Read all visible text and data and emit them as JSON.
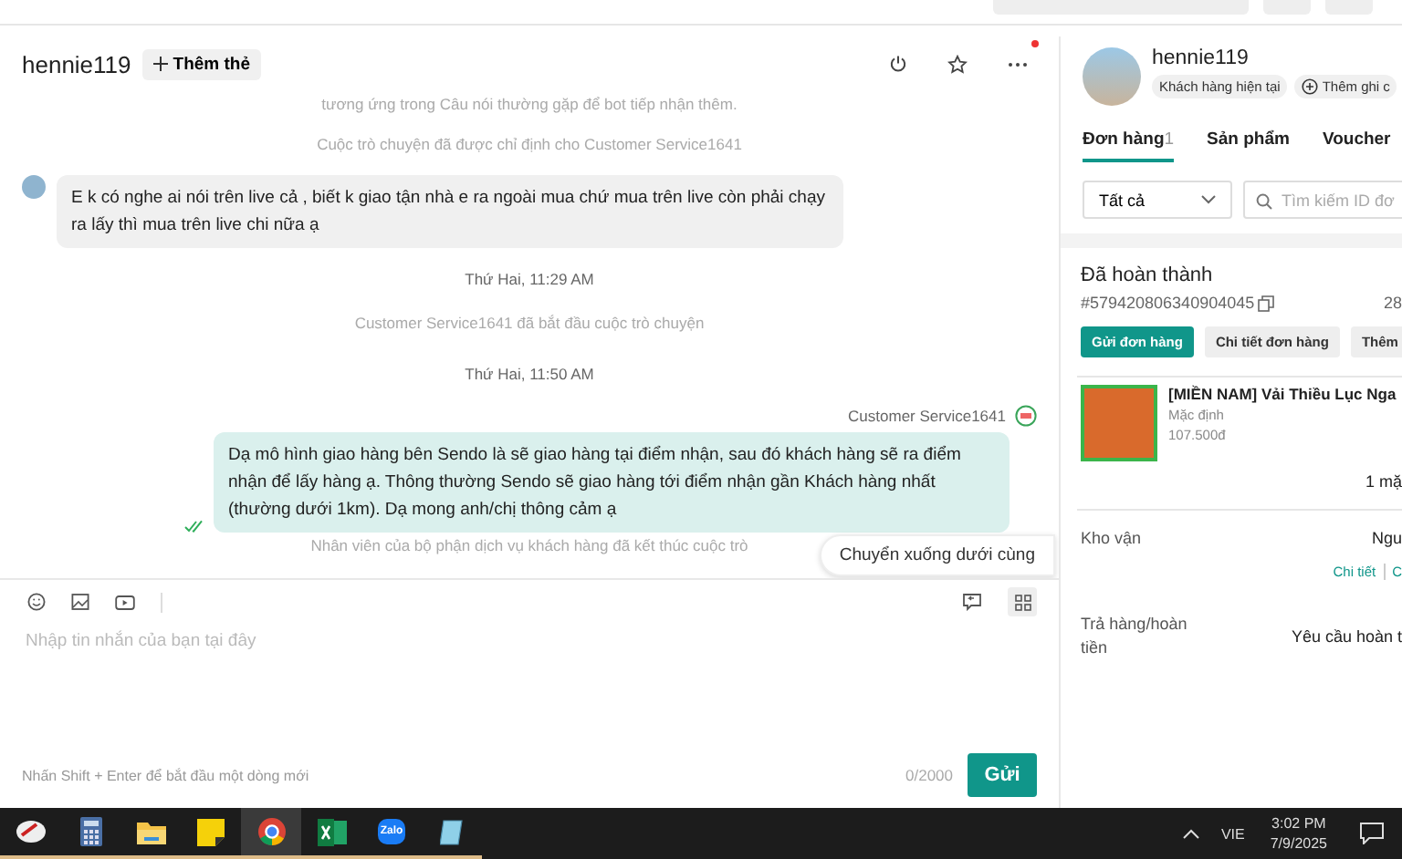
{
  "chat": {
    "header": {
      "username": "hennie119",
      "add_tag_button": "Thêm thẻ",
      "has_notification": true
    },
    "messages": [
      {
        "kind": "system",
        "text": "tương ứng trong Câu nói thường gặp để bot tiếp nhận thêm."
      },
      {
        "kind": "system",
        "text": "Cuộc trò chuyện đã được chỉ định cho Customer Service1641"
      },
      {
        "kind": "incoming",
        "text": "E k có nghe ai nói trên live cả , biết k giao tận nhà e ra ngoài mua chứ mua trên live còn phải chạy ra lấy thì mua trên live chi nữa ạ"
      },
      {
        "kind": "time",
        "text": "Thứ Hai, 11:29 AM"
      },
      {
        "kind": "system",
        "text": "Customer Service1641 đã bắt đầu cuộc trò chuyện"
      },
      {
        "kind": "time",
        "text": "Thứ Hai, 11:50 AM"
      },
      {
        "kind": "outgoing",
        "sender": "Customer Service1641",
        "read": true,
        "text": "Dạ mô hình giao hàng bên Sendo là sẽ giao hàng tại điểm nhận, sau đó khách hàng sẽ ra điểm nhận để lấy hàng ạ. Thông thường Sendo sẽ giao hàng tới điểm nhận gần Khách hàng nhất (thường dưới 1km). Dạ mong anh/chị thông cảm ạ"
      },
      {
        "kind": "system",
        "text": "Nhân viên của bộ phận dịch vụ khách hàng đã kết thúc cuộc trò"
      }
    ],
    "scroll_bottom_button": "Chuyển xuống dưới cùng",
    "composer": {
      "placeholder": "Nhập tin nhắn của bạn tại đây",
      "hint": "Nhấn Shift + Enter để bắt đầu một dòng mới",
      "counter": "0/2000",
      "send_button": "Gửi"
    }
  },
  "customer": {
    "name": "hennie119",
    "badge": "Khách hàng hiện tại",
    "add_note": "Thêm ghi c",
    "tabs": [
      {
        "label": "Đơn hàng",
        "count": "1",
        "selected": true
      },
      {
        "label": "Sản phẩm",
        "selected": false
      },
      {
        "label": "Voucher",
        "selected": false
      }
    ],
    "filter": {
      "value": "Tất cả"
    },
    "search": {
      "placeholder": "Tìm kiếm ID đơ"
    },
    "order": {
      "status": "Đã hoàn thành",
      "id": "#579420806340904045",
      "date": "28",
      "actions": [
        {
          "label": "Gửi đơn hàng",
          "primary": true
        },
        {
          "label": "Chi tiết đơn hàng",
          "primary": false
        },
        {
          "label": "Thêm",
          "primary": false
        }
      ],
      "product": {
        "name": "[MIỀN NAM] Vải Thiều Lục Nga",
        "variant": "Mặc định",
        "price": "107.500đ"
      },
      "quantity": "1 mặ",
      "shipping": {
        "label": "Kho vận",
        "value": "Ngu",
        "links": [
          "Chi tiết",
          "C"
        ]
      },
      "refund": {
        "label": "Trả hàng/hoàn tiền",
        "value": "Yêu cầu hoàn t"
      }
    }
  },
  "taskbar": {
    "apps": [
      {
        "kind": "tool",
        "selected": false
      },
      {
        "kind": "calculator",
        "selected": false
      },
      {
        "kind": "folder",
        "selected": false
      },
      {
        "kind": "notes",
        "selected": false
      },
      {
        "kind": "browser",
        "selected": true
      },
      {
        "kind": "excel",
        "selected": false
      },
      {
        "kind": "zalo",
        "label": "Zalo",
        "selected": false
      },
      {
        "kind": "notepad",
        "selected": false
      }
    ],
    "language": "VIE",
    "time": "3:02 PM",
    "date": "7/9/2025"
  }
}
